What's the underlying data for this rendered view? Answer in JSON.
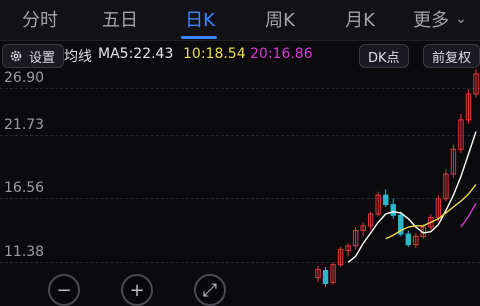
{
  "tabs": [
    {
      "label": "分时",
      "active": false
    },
    {
      "label": "五日",
      "active": false
    },
    {
      "label": "日K",
      "active": true
    },
    {
      "label": "周K",
      "active": false
    },
    {
      "label": "月K",
      "active": false
    },
    {
      "label": "更多",
      "active": false
    }
  ],
  "toolbar": {
    "settings_label": "设置",
    "ma_label": "均线",
    "ma5": "MA5:22.43",
    "ma10": "10:18.54",
    "ma20": "20:16.86",
    "dk_label": "DK点",
    "restore_label": "前复权"
  },
  "y_axis": {
    "labels": [
      "26.90",
      "21.73",
      "16.56",
      "11.38"
    ]
  },
  "controls": {
    "zoom_out": "−",
    "zoom_in": "+",
    "fullscreen": "⤢"
  },
  "colors": {
    "up": "#e8353a",
    "down": "#2db8c9",
    "ma5": "#ffffff",
    "ma10": "#eadc4a",
    "ma20": "#d63ad7",
    "accent": "#3f84ff"
  },
  "chart_data": {
    "type": "candlestick",
    "ylim": [
      8.7,
      28.4
    ],
    "candles": [
      {
        "o": 10.6,
        "h": 11.6,
        "l": 10.2,
        "c": 11.3
      },
      {
        "o": 11.2,
        "h": 11.5,
        "l": 9.8,
        "c": 10.1
      },
      {
        "o": 10.2,
        "h": 11.9,
        "l": 10.0,
        "c": 11.7
      },
      {
        "o": 11.7,
        "h": 13.2,
        "l": 11.5,
        "c": 13.0
      },
      {
        "o": 12.9,
        "h": 13.5,
        "l": 12.4,
        "c": 13.3
      },
      {
        "o": 13.3,
        "h": 14.9,
        "l": 13.0,
        "c": 14.6
      },
      {
        "o": 14.6,
        "h": 15.3,
        "l": 14.1,
        "c": 15.0
      },
      {
        "o": 15.0,
        "h": 16.2,
        "l": 14.7,
        "c": 16.0
      },
      {
        "o": 16.0,
        "h": 17.9,
        "l": 15.8,
        "c": 17.6
      },
      {
        "o": 17.6,
        "h": 18.1,
        "l": 16.6,
        "c": 16.8
      },
      {
        "o": 16.8,
        "h": 17.3,
        "l": 15.6,
        "c": 15.9
      },
      {
        "o": 15.9,
        "h": 16.2,
        "l": 14.1,
        "c": 14.3
      },
      {
        "o": 14.3,
        "h": 14.6,
        "l": 13.2,
        "c": 13.4
      },
      {
        "o": 13.4,
        "h": 14.4,
        "l": 13.1,
        "c": 14.1
      },
      {
        "o": 14.1,
        "h": 15.1,
        "l": 13.9,
        "c": 14.9
      },
      {
        "o": 14.9,
        "h": 16.0,
        "l": 14.6,
        "c": 15.7
      },
      {
        "o": 15.7,
        "h": 17.6,
        "l": 15.4,
        "c": 17.3
      },
      {
        "o": 17.3,
        "h": 19.8,
        "l": 17.1,
        "c": 19.4
      },
      {
        "o": 19.4,
        "h": 21.9,
        "l": 19.1,
        "c": 21.5
      },
      {
        "o": 21.5,
        "h": 24.5,
        "l": 21.2,
        "c": 24.0
      },
      {
        "o": 24.0,
        "h": 26.6,
        "l": 23.7,
        "c": 26.2
      },
      {
        "o": 26.2,
        "h": 28.3,
        "l": 25.9,
        "c": 27.9
      }
    ],
    "series": [
      {
        "name": "MA5",
        "values": [
          null,
          null,
          null,
          null,
          11.9,
          12.4,
          13.5,
          14.4,
          15.3,
          16.0,
          16.2,
          16.1,
          15.6,
          14.9,
          14.4,
          14.5,
          15.1,
          16.3,
          17.6,
          19.2,
          21.1,
          23.0
        ]
      },
      {
        "name": "MA10",
        "values": [
          null,
          null,
          null,
          null,
          null,
          null,
          null,
          null,
          null,
          13.9,
          14.2,
          14.6,
          14.9,
          15.0,
          15.0,
          15.3,
          15.6,
          16.1,
          16.6,
          17.1,
          17.7,
          18.5
        ]
      },
      {
        "name": "MA20",
        "values": [
          null,
          null,
          null,
          null,
          null,
          null,
          null,
          null,
          null,
          null,
          null,
          null,
          null,
          null,
          null,
          null,
          null,
          null,
          null,
          14.9,
          15.8,
          16.9
        ]
      }
    ]
  }
}
